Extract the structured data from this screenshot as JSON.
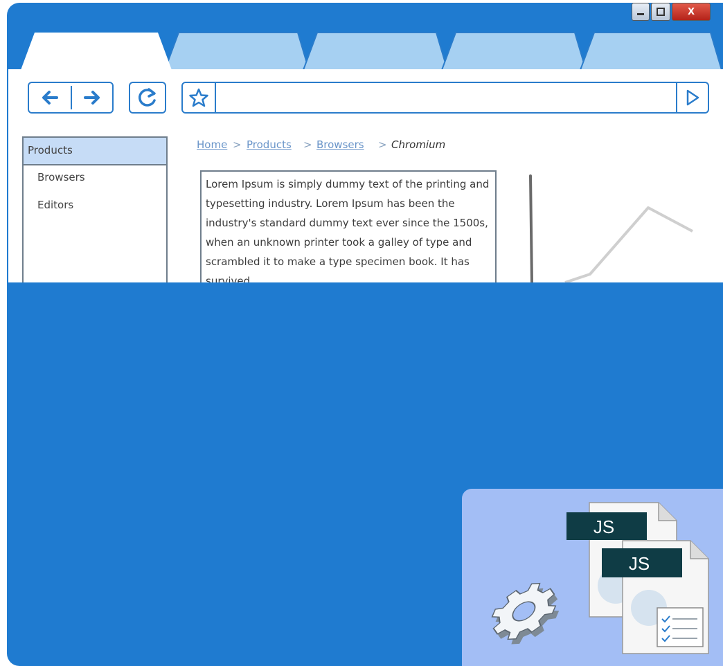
{
  "window": {
    "minimize_icon": "minimize-icon",
    "maximize_icon": "maximize-icon",
    "close_label": "X"
  },
  "tabs": [
    {
      "state": "active"
    },
    {
      "state": "inactive"
    },
    {
      "state": "inactive"
    },
    {
      "state": "inactive"
    },
    {
      "state": "inactive"
    }
  ],
  "toolbar": {
    "back_icon": "arrow-left-icon",
    "forward_icon": "arrow-right-icon",
    "refresh_icon": "refresh-icon",
    "bookmark_icon": "star-icon",
    "go_icon": "play-icon",
    "url_value": ""
  },
  "sidebar": {
    "header": "Products",
    "items": [
      {
        "label": "Browsers"
      },
      {
        "label": "Editors"
      }
    ]
  },
  "breadcrumb": {
    "items": [
      {
        "label": "Home",
        "link": true
      },
      {
        "label": "Products",
        "link": true
      },
      {
        "label": "Browsers",
        "link": true
      },
      {
        "label": "Chromium",
        "link": false
      }
    ],
    "separator": ">"
  },
  "main": {
    "paragraph": "Lorem Ipsum is simply dummy text of the printing and typesetting industry. Lorem Ipsum has been the industry's standard dummy text ever since the 1500s, when an unknown printer took a galley of type and scrambled it to make a type specimen book. It has survived"
  },
  "thumbnail": {
    "badge1": "JS",
    "badge2": "JS"
  },
  "colors": {
    "frame": "#1f7bd0",
    "tab_inactive": "#a6d0f2",
    "accent": "#2a7ccb",
    "thumbnail_bg": "#a3bef5",
    "badge": "#0f3c45"
  }
}
